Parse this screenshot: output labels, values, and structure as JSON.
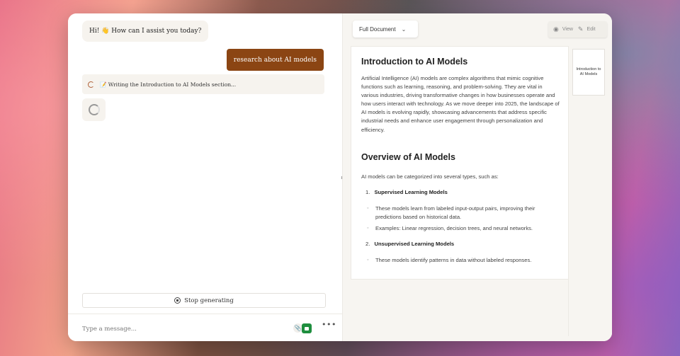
{
  "chat": {
    "ai_greeting": "Hi! 👋 How can I assist you today?",
    "user_message": "research about AI models",
    "status_text": "📝 Writing the Introduction to AI Models section...",
    "stop_label": "Stop generating",
    "input_placeholder": "Type a message...",
    "more_label": "•••"
  },
  "doc": {
    "selector_label": "Full Document",
    "view_label": "View",
    "edit_label": "Edit",
    "heading1": "Introduction to AI Models",
    "para1": "Artificial Intelligence (AI) models are complex algorithms that mimic cognitive functions such as learning, reasoning, and problem-solving. They are vital in various industries, driving transformative changes in how businesses operate and how users interact with technology. As we move deeper into 2025, the landscape of AI models is evolving rapidly, showcasing advancements that address specific industrial needs and enhance user engagement through personalization and efficiency.",
    "heading2": "Overview of AI Models",
    "para2": "AI models can be categorized into several types, such as:",
    "items": [
      {
        "num": "1.",
        "title": "Supervised Learning Models",
        "bullets": [
          "These models learn from labeled input-output pairs, improving their predictions based on historical data.",
          "Examples: Linear regression, decision trees, and neural networks."
        ]
      },
      {
        "num": "2.",
        "title": "Unsupervised Learning Models",
        "bullets": [
          "These models identify patterns in data without labeled responses."
        ]
      }
    ],
    "thumbnail_label": "Introduction to AI Models"
  }
}
